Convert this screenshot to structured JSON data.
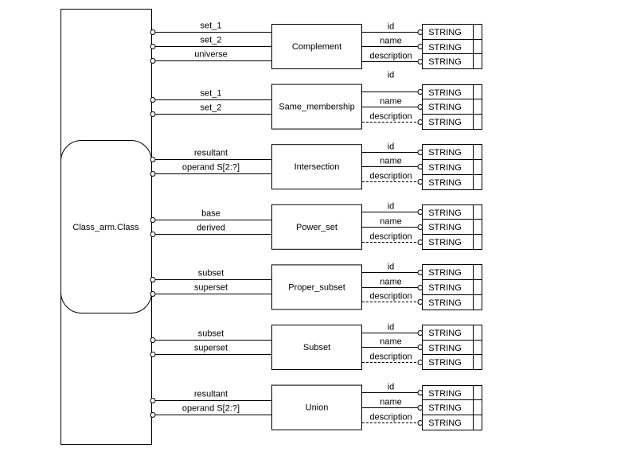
{
  "main_entity": {
    "label": "Class_arm.Class"
  },
  "string_type_label": "STRING",
  "entities": [
    {
      "name": "Complement",
      "left_attrs": [
        "set_1",
        "set_2",
        "universe"
      ],
      "right_attrs": [
        {
          "label": "id",
          "optional": false
        },
        {
          "label": "name",
          "optional": false
        },
        {
          "label": "description",
          "optional": false
        }
      ]
    },
    {
      "name": "Same_membership",
      "left_attrs": [
        "set_1",
        "set_2"
      ],
      "right_attrs": [
        {
          "label": "id",
          "optional": false
        },
        {
          "label": "name",
          "optional": false
        },
        {
          "label": "description",
          "optional": true
        }
      ]
    },
    {
      "name": "Intersection",
      "left_attrs": [
        "resultant",
        "operand S[2:?]"
      ],
      "right_attrs": [
        {
          "label": "id",
          "optional": false
        },
        {
          "label": "name",
          "optional": false
        },
        {
          "label": "description",
          "optional": true
        }
      ]
    },
    {
      "name": "Power_set",
      "left_attrs": [
        "base",
        "derived"
      ],
      "right_attrs": [
        {
          "label": "id",
          "optional": false
        },
        {
          "label": "name",
          "optional": false
        },
        {
          "label": "description",
          "optional": true
        }
      ]
    },
    {
      "name": "Proper_subset",
      "left_attrs": [
        "subset",
        "superset"
      ],
      "right_attrs": [
        {
          "label": "id",
          "optional": false
        },
        {
          "label": "name",
          "optional": false
        },
        {
          "label": "description",
          "optional": true
        }
      ]
    },
    {
      "name": "Subset",
      "left_attrs": [
        "subset",
        "superset"
      ],
      "right_attrs": [
        {
          "label": "id",
          "optional": false
        },
        {
          "label": "name",
          "optional": false
        },
        {
          "label": "description",
          "optional": true
        }
      ]
    },
    {
      "name": "Union",
      "left_attrs": [
        "resultant",
        "operand S[2:?]"
      ],
      "right_attrs": [
        {
          "label": "id",
          "optional": false
        },
        {
          "label": "name",
          "optional": false
        },
        {
          "label": "description",
          "optional": true
        }
      ]
    }
  ]
}
